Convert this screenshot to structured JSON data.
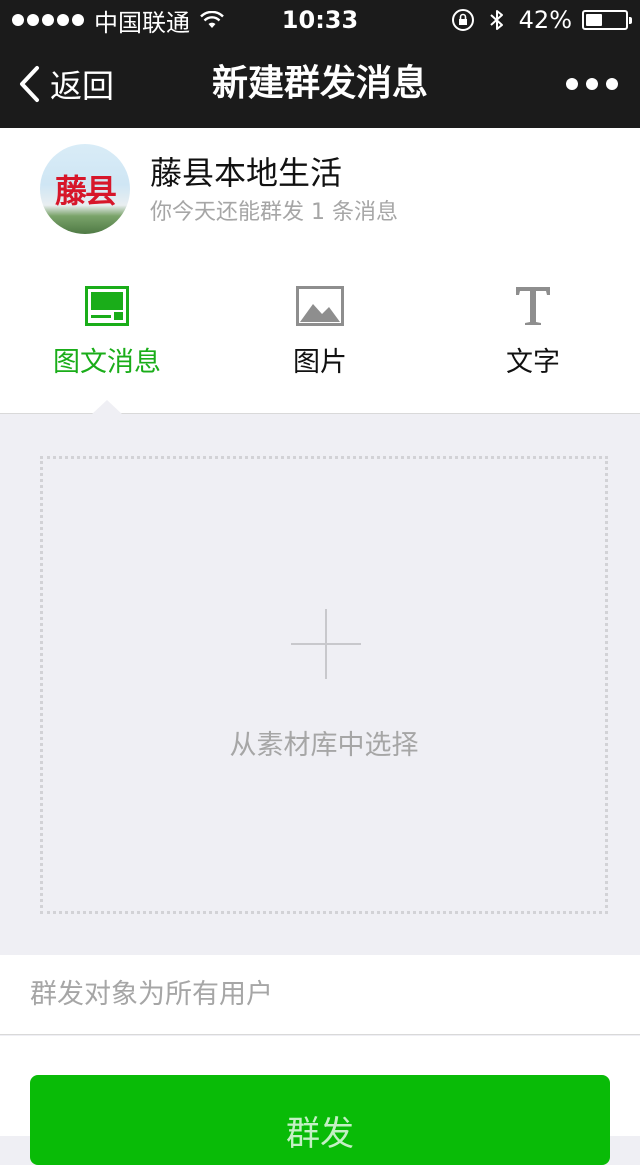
{
  "status_bar": {
    "carrier": "中国联通",
    "time": "10:33",
    "battery_percent": "42%",
    "battery_level": 0.42,
    "icons": [
      "signal-dots",
      "wifi-icon",
      "rotation-lock-icon",
      "bluetooth-icon",
      "battery-icon"
    ]
  },
  "nav": {
    "back_label": "返回",
    "title": "新建群发消息"
  },
  "account": {
    "avatar_text": "藤县",
    "name": "藤县本地生活",
    "quota_text": "你今天还能群发 1 条消息"
  },
  "tabs": [
    {
      "label": "图文消息",
      "icon": "news-icon",
      "active": true
    },
    {
      "label": "图片",
      "icon": "image-icon",
      "active": false
    },
    {
      "label": "文字",
      "icon": "text-icon",
      "active": false
    }
  ],
  "content": {
    "select_label": "从素材库中选择"
  },
  "target": {
    "label": "群发对象为所有用户"
  },
  "send": {
    "label": "群发"
  },
  "colors": {
    "accent_green": "#1aad19",
    "button_green": "#09bb07",
    "nav_bg": "#1b1b1b",
    "page_bg": "#efeff4"
  }
}
